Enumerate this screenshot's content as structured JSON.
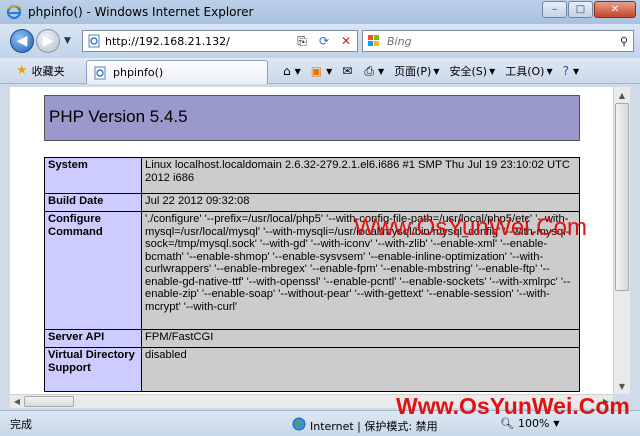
{
  "window": {
    "title": "phpinfo() - Windows Internet Explorer",
    "buttons": {
      "minimize": "–",
      "maximize": "□",
      "close": "✕"
    }
  },
  "nav": {
    "url": "http://192.168.21.132/",
    "search_placeholder": "Bing"
  },
  "command_bar": {
    "favorites": "收藏夹",
    "tab_title": "phpinfo()",
    "page_menu": "页面(P)",
    "safety_menu": "安全(S)",
    "tools_menu": "工具(O)"
  },
  "page": {
    "header": "PHP Version 5.4.5",
    "rows": [
      {
        "key": "System",
        "value": "Linux localhost.localdomain 2.6.32-279.2.1.el6.i686 #1 SMP Thu Jul 19 23:10:02 UTC 2012 i686"
      },
      {
        "key": "Build Date",
        "value": "Jul 22 2012 09:32:08"
      },
      {
        "key": "Configure Command",
        "value": "'./configure' '--prefix=/usr/local/php5' '--with-config-file-path=/usr/local/php5/etc' '--with-mysql=/usr/local/mysql' '--with-mysqli=/usr/local/mysql/bin/mysql_config' '--with-mysql-sock=/tmp/mysql.sock' '--with-gd' '--with-iconv' '--with-zlib' '--enable-xml' '--enable-bcmath' '--enable-shmop' '--enable-sysvsem' '--enable-inline-optimization' '--with-curlwrappers' '--enable-mbregex' '--enable-fpm' '--enable-mbstring' '--enable-ftp' '--enable-gd-native-ttf' '--with-openssl' '--enable-pcntl' '--enable-sockets' '--with-xmlrpc' '--enable-zip' '--enable-soap' '--without-pear' '--with-gettext' '--enable-session' '--with-mcrypt' '--with-curl'"
      },
      {
        "key": "Server API",
        "value": "FPM/FastCGI"
      },
      {
        "key": "Virtual Directory Support",
        "value": "disabled"
      }
    ]
  },
  "watermark": "Www.OsYunWei.Com",
  "status": {
    "text": "完成",
    "zone": "Internet | 保护模式: 禁用",
    "zoom": "100%"
  }
}
